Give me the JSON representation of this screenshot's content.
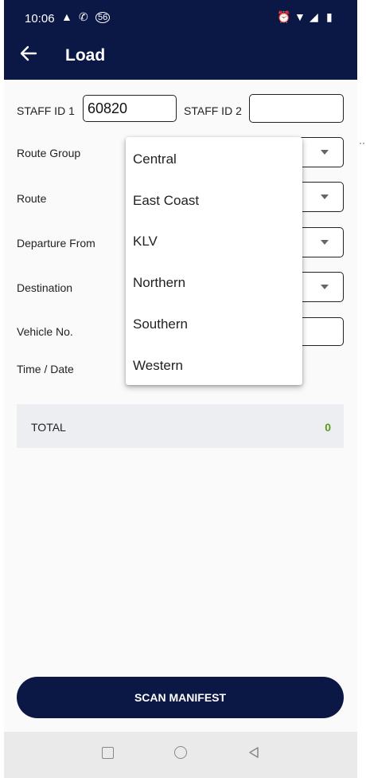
{
  "status_bar": {
    "time": "10:06",
    "badge": "56"
  },
  "app_bar": {
    "title": "Load"
  },
  "form": {
    "staff_id_1_label": "STAFF ID 1",
    "staff_id_1_value": "60820",
    "staff_id_2_label": "STAFF ID 2",
    "staff_id_2_value": "",
    "route_group_label": "Route Group",
    "route_label": "Route",
    "departure_label": "Departure From",
    "destination_label": "Destination",
    "vehicle_label": "Vehicle No.",
    "time_date_label": "Time / Date"
  },
  "dropdown_options": [
    "Central",
    "East Coast",
    "KLV",
    "Northern",
    "Southern",
    "Western"
  ],
  "total": {
    "label": "TOTAL",
    "value": "0"
  },
  "scan_button": {
    "label": "SCAN MANIFEST"
  },
  "colors": {
    "primary": "#0b1846",
    "total_value": "#5a9a1c",
    "background": "#fafafa"
  }
}
